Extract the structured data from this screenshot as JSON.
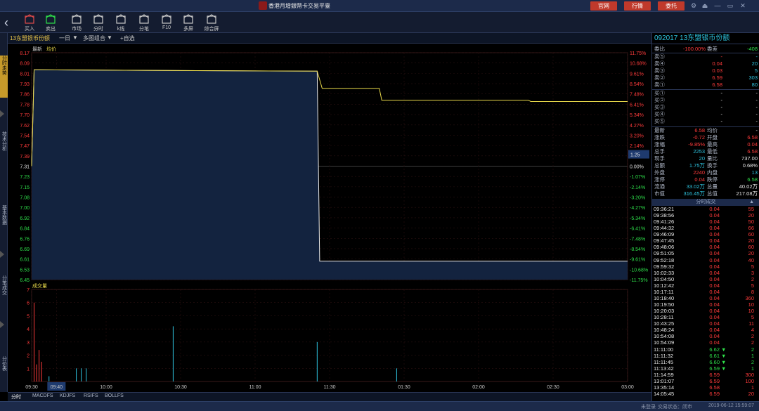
{
  "app": {
    "title": "香港月增銀幣卡交易平臺",
    "buttons": [
      "官网",
      "行情",
      "委托"
    ]
  },
  "toolbar": {
    "items": [
      {
        "label": "买入",
        "icon": "house-buy-icon"
      },
      {
        "label": "卖出",
        "icon": "house-sell-icon"
      },
      {
        "label": "市场",
        "icon": "bag-icon"
      },
      {
        "label": "分时",
        "icon": "timeshare-icon"
      },
      {
        "label": "k线",
        "icon": "candlestick-icon"
      },
      {
        "label": "分笔",
        "icon": "list-icon"
      },
      {
        "label": "F10",
        "icon": "document-icon"
      },
      {
        "label": "多屏",
        "icon": "multiscreen-icon"
      },
      {
        "label": "综合屏",
        "icon": "grid-icon"
      }
    ]
  },
  "sidebar": {
    "items": [
      "分时走势",
      "技术分析",
      "基本数据",
      "分笔成交",
      "分价表"
    ]
  },
  "chart_header": {
    "stock_tab": "13东盟银币份额",
    "periods": [
      "一日",
      "多图组合",
      "+自选"
    ]
  },
  "legend": {
    "latest": "最新",
    "avg": "均价"
  },
  "volume_title": "成交量",
  "bottom_tabs": [
    "分时",
    "MACDFS",
    "KDJFS",
    "RSIFS",
    "BOLLFS"
  ],
  "status": {
    "left": "未登录",
    "mid": "交易状态：闭市",
    "datetime": "2019-06-12 15:59:07"
  },
  "chart_data": {
    "type": "line",
    "title": "",
    "x_ticks": [
      "09:30",
      "09:40",
      "10:00",
      "10:30",
      "11:00",
      "11:30",
      "01:30",
      "02:00",
      "02:30",
      "03:00"
    ],
    "y_ticks_left": [
      "8.17",
      "8.09",
      "8.01",
      "7.93",
      "7.86",
      "7.78",
      "7.70",
      "7.62",
      "7.54",
      "7.47",
      "7.39",
      "7.31",
      "7.23",
      "7.15",
      "7.08",
      "7.00",
      "6.92",
      "6.84",
      "6.76",
      "6.69",
      "6.61",
      "6.53",
      "6.45"
    ],
    "y_ticks_right": [
      "11.75%",
      "10.68%",
      "9.61%",
      "8.54%",
      "7.48%",
      "6.41%",
      "5.34%",
      "4.27%",
      "3.20%",
      "2.14%",
      "1.07%",
      "0.00%",
      "-1.07%",
      "-2.14%",
      "-3.20%",
      "-4.27%",
      "-5.34%",
      "-6.41%",
      "-7.48%",
      "-8.54%",
      "-9.61%",
      "-10.68%",
      "-11.75%"
    ],
    "prev_close": 7.31,
    "cursor_value": "1.25",
    "ylim": [
      6.45,
      8.17
    ],
    "x_minutes": 240,
    "series": [
      {
        "name": "最新",
        "color": "#e8e8e8",
        "points": [
          [
            0,
            7.31
          ],
          [
            1,
            8.04
          ],
          [
            3,
            8.04
          ],
          [
            115,
            8.03
          ],
          [
            116,
            6.59
          ],
          [
            240,
            6.59
          ]
        ]
      },
      {
        "name": "均价",
        "color": "#e8d84a",
        "points": [
          [
            0,
            7.31
          ],
          [
            1,
            8.04
          ],
          [
            3,
            8.04
          ],
          [
            115,
            8.03
          ],
          [
            117,
            7.9
          ],
          [
            140,
            7.9
          ],
          [
            141,
            7.81
          ],
          [
            200,
            7.81
          ],
          [
            201,
            7.8
          ],
          [
            240,
            7.8
          ]
        ]
      }
    ],
    "volume": {
      "ylim": [
        0,
        7
      ],
      "y_ticks": [
        "7",
        "6",
        "5",
        "4",
        "3",
        "2",
        "1"
      ],
      "bars": [
        [
          1,
          6
        ],
        [
          2,
          1.3
        ],
        [
          3,
          2.4
        ],
        [
          4,
          1.5
        ],
        [
          7,
          0.4
        ],
        [
          18,
          1
        ],
        [
          20,
          1
        ],
        [
          22,
          1
        ],
        [
          57,
          4.2
        ],
        [
          115,
          3
        ],
        [
          147,
          1
        ]
      ]
    }
  },
  "quote": {
    "code": "092017",
    "name": "13东盟银币份额",
    "stats": [
      {
        "l": "委比",
        "v": "-100.00%",
        "l2": "委差",
        "v2": "-408"
      }
    ],
    "sell": [
      {
        "l": "卖⑤",
        "p": "-",
        "q": "-"
      },
      {
        "l": "卖④",
        "p": "0.04",
        "q": "20"
      },
      {
        "l": "卖③",
        "p": "0.03",
        "q": "5"
      },
      {
        "l": "卖②",
        "p": "6.59",
        "q": "303"
      },
      {
        "l": "卖①",
        "p": "6.58",
        "q": "80"
      }
    ],
    "buy": [
      {
        "l": "买①",
        "p": "-",
        "q": "-"
      },
      {
        "l": "买②",
        "p": "-",
        "q": "-"
      },
      {
        "l": "买③",
        "p": "-",
        "q": "-"
      },
      {
        "l": "买④",
        "p": "-",
        "q": "-"
      },
      {
        "l": "买⑤",
        "p": "-",
        "q": "-"
      }
    ],
    "detail": [
      {
        "l": "最新",
        "v": "6.58",
        "l2": "均价",
        "v2": "-"
      },
      {
        "l": "涨跌",
        "v": "-0.72",
        "l2": "开盘",
        "v2": "6.58"
      },
      {
        "l": "涨幅",
        "v": "-9.85%",
        "l2": "最高",
        "v2": "0.04"
      },
      {
        "l": "总手",
        "v": "2253",
        "l2": "最低",
        "v2": "6.58"
      },
      {
        "l": "现手",
        "v": "20",
        "l2": "量比",
        "v2": "737.00"
      },
      {
        "l": "总额",
        "v": "1.75万",
        "l2": "换手",
        "v2": "0.68%"
      },
      {
        "l": "外盘",
        "v": "2240",
        "l2": "内盘",
        "v2": "13"
      },
      {
        "l": "涨停",
        "v": "0.04",
        "l2": "跌停",
        "v2": "6.58"
      },
      {
        "l": "流通",
        "v": "33.02万",
        "l2": "总量",
        "v2": "40.02万"
      },
      {
        "l": "市值",
        "v": "316.45万",
        "l2": "总值",
        "v2": "217.08万"
      }
    ],
    "trades_header": "分时成交",
    "trades": [
      [
        "09:36:21",
        "0.04",
        "55",
        ""
      ],
      [
        "09:38:56",
        "0.04",
        "20",
        ""
      ],
      [
        "09:41:26",
        "0.04",
        "50",
        ""
      ],
      [
        "09:44:32",
        "0.04",
        "66",
        ""
      ],
      [
        "09:46:09",
        "0.04",
        "60",
        ""
      ],
      [
        "09:47:45",
        "0.04",
        "20",
        ""
      ],
      [
        "09:48:06",
        "0.04",
        "60",
        ""
      ],
      [
        "09:51:05",
        "0.04",
        "20",
        ""
      ],
      [
        "09:52:18",
        "0.04",
        "40",
        ""
      ],
      [
        "09:59:32",
        "0.04",
        "5",
        ""
      ],
      [
        "10:02:33",
        "0.04",
        "3",
        ""
      ],
      [
        "10:04:50",
        "0.04",
        "2",
        ""
      ],
      [
        "10:12:42",
        "0.04",
        "5",
        ""
      ],
      [
        "10:17:11",
        "0.04",
        "8",
        ""
      ],
      [
        "10:18:40",
        "0.04",
        "360",
        ""
      ],
      [
        "10:19:50",
        "0.04",
        "10",
        ""
      ],
      [
        "10:20:03",
        "0.04",
        "10",
        ""
      ],
      [
        "10:28:11",
        "0.04",
        "5",
        ""
      ],
      [
        "10:43:25",
        "0.04",
        "11",
        ""
      ],
      [
        "10:48:24",
        "0.04",
        "4",
        ""
      ],
      [
        "10:54:08",
        "0.04",
        "2",
        ""
      ],
      [
        "10:54:09",
        "0.04",
        "2",
        ""
      ],
      [
        "11:11:00",
        "6.62",
        "2",
        "▼"
      ],
      [
        "11:11:32",
        "6.61",
        "1",
        "▼"
      ],
      [
        "11:11:45",
        "6.60",
        "2",
        "▼"
      ],
      [
        "11:13:42",
        "6.59",
        "1",
        "▼"
      ],
      [
        "11:14:59",
        "6.59",
        "300",
        ""
      ],
      [
        "13:01:07",
        "6.59",
        "100",
        ""
      ],
      [
        "13:35:14",
        "6.58",
        "1",
        ""
      ],
      [
        "14:05:45",
        "6.59",
        "20",
        ""
      ]
    ]
  }
}
